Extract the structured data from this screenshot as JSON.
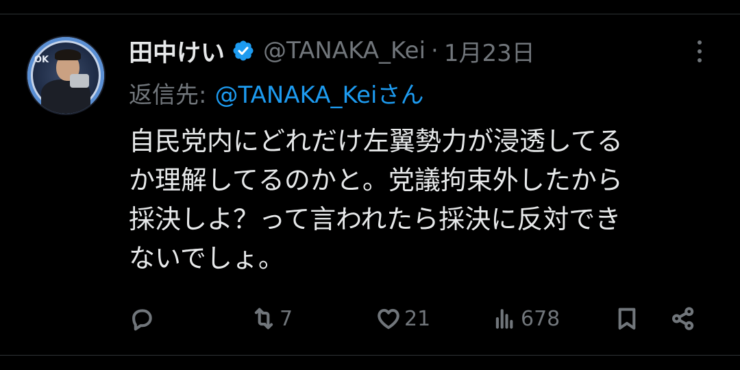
{
  "tweet": {
    "author": {
      "display_name": "田中けい",
      "handle": "@TANAKA_Kei",
      "avatar_label": "OK"
    },
    "separator": "·",
    "date": "1月23日",
    "reply": {
      "label": "返信先:",
      "handle": "@TANAKA_Keiさん"
    },
    "text": "自民党内にどれだけ左翼勢力が浸透してるか理解してるのかと。党議拘束外したから採決しよ？って言われたら採決に反対できないでしょ。",
    "text_lines": [
      "自民党内にどれだけ左翼勢力が浸透してる",
      "か理解してるのかと。党議拘束外したから",
      "採決しよ？って言われたら採決に反対でき",
      "ないでしょ。"
    ],
    "actions": {
      "reply": {
        "icon": "reply-icon",
        "count": ""
      },
      "retweet": {
        "icon": "retweet-icon",
        "count": "7"
      },
      "like": {
        "icon": "heart-icon",
        "count": "21"
      },
      "views": {
        "icon": "views-icon",
        "count": "678"
      },
      "bookmark": {
        "icon": "bookmark-icon",
        "count": ""
      },
      "share": {
        "icon": "share-icon",
        "count": ""
      }
    }
  },
  "colors": {
    "background": "#000000",
    "primary_text": "#e7e9ea",
    "secondary_text": "#71767b",
    "accent": "#1d9bf0",
    "divider": "#2f3336"
  }
}
